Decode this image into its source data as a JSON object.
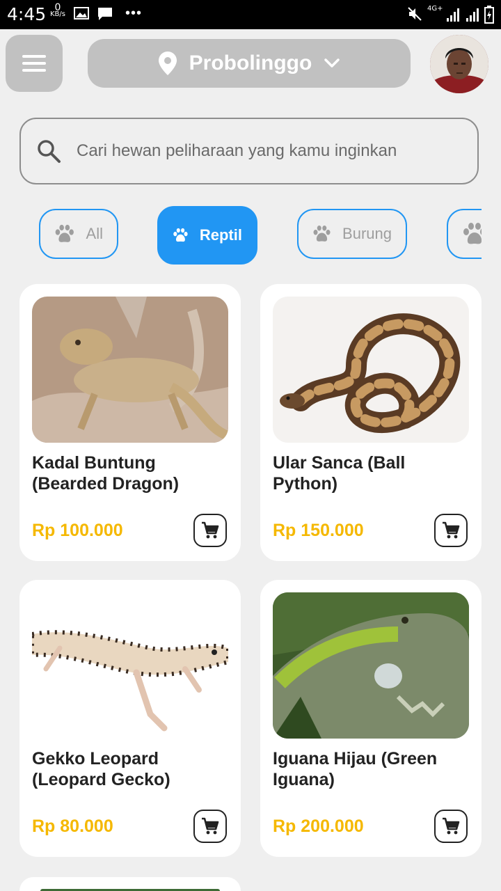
{
  "status_bar": {
    "time": "4:45",
    "kb_value": "0",
    "kb_unit": "KB/s",
    "dots": "•••",
    "network": "4G+"
  },
  "header": {
    "location": "Probolinggo"
  },
  "search": {
    "placeholder": "Cari hewan peliharaan yang kamu inginkan"
  },
  "categories": [
    {
      "label": "All",
      "active": false
    },
    {
      "label": "Reptil",
      "active": true
    },
    {
      "label": "Burung",
      "active": false
    },
    {
      "label": "",
      "active": false
    }
  ],
  "products": [
    {
      "name": "Kadal Buntung (Bearded Dragon)",
      "price": "Rp 100.000",
      "icon": "bearded-dragon-photo"
    },
    {
      "name": "Ular Sanca (Ball Python)",
      "price": "Rp 150.000",
      "icon": "ball-python-photo"
    },
    {
      "name": "Gekko Leopard (Leopard Gecko)",
      "price": "Rp 80.000",
      "icon": "leopard-gecko-photo"
    },
    {
      "name": "Iguana Hijau (Green Iguana)",
      "price": "Rp 200.000",
      "icon": "green-iguana-photo"
    }
  ],
  "colors": {
    "accent": "#2196f3",
    "price": "#f5b800",
    "pill": "#c1c1c1",
    "background": "#efefef"
  }
}
